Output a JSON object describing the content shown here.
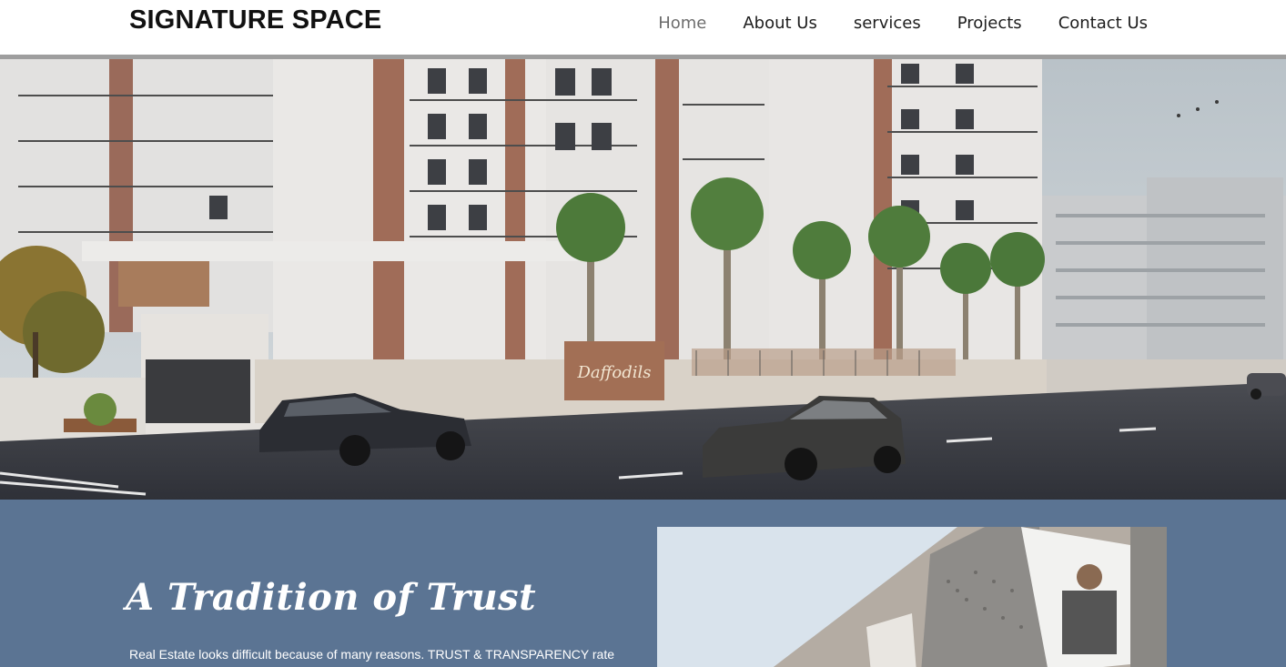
{
  "header": {
    "logo": "SIGNATURE SPACE",
    "nav": [
      {
        "label": "Home",
        "active": true
      },
      {
        "label": "About Us",
        "active": false
      },
      {
        "label": "services",
        "active": false
      },
      {
        "label": "Projects",
        "active": false
      },
      {
        "label": "Contact Us",
        "active": false
      }
    ]
  },
  "hero": {
    "signage_text": "Daffodils"
  },
  "about": {
    "title": "A Tradition of Trust",
    "body": "Real Estate looks difficult because of many reasons. TRUST & TRANSPARENCY rate"
  },
  "colors": {
    "section_bg": "#5b7493",
    "header_rule": "#9e9e9e",
    "nav_active": "#6d6d6d"
  }
}
